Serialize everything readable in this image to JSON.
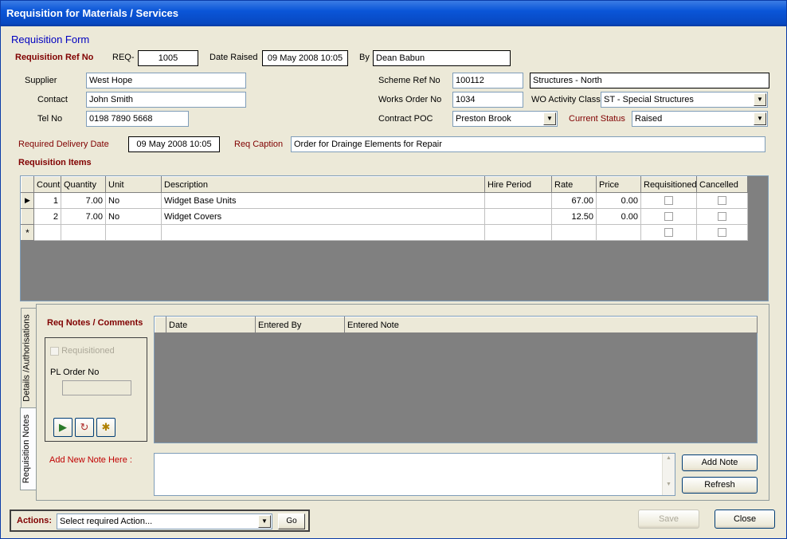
{
  "window": {
    "title": "Requisition for Materials / Services"
  },
  "form": {
    "heading": "Requisition Form",
    "ref_label": "Requisition Ref No",
    "ref_prefix": "REQ-",
    "ref_value": "1005",
    "date_raised_label": "Date Raised",
    "date_raised_value": "09 May 2008 10:05",
    "by_label": "By",
    "by_value": "Dean Babun",
    "supplier_label": "Supplier",
    "supplier_value": "West Hope",
    "contact_label": "Contact",
    "contact_value": "John Smith",
    "tel_label": "Tel No",
    "tel_value": "0198 7890 5668",
    "scheme_label": "Scheme Ref No",
    "scheme_value": "100112",
    "scheme_name": "Structures - North",
    "works_order_label": "Works Order No",
    "works_order_value": "1034",
    "wo_activity_label": "WO Activity Class",
    "wo_activity_value": "ST - Special Structures",
    "contract_poc_label": "Contract POC",
    "contract_poc_value": "Preston Brook",
    "status_label": "Current Status",
    "status_value": "Raised",
    "delivery_label": "Required Delivery Date",
    "delivery_value": "09 May 2008 10:05",
    "caption_label": "Req Caption",
    "caption_value": "Order for Drainge Elements for Repair"
  },
  "items": {
    "heading": "Requisition Items",
    "columns": [
      "Count",
      "Quantity",
      "Unit",
      "Description",
      "Hire Period",
      "Rate",
      "Price",
      "Requisitioned",
      "Cancelled"
    ],
    "rows": [
      {
        "marker": "▶",
        "count": "1",
        "quantity": "7.00",
        "unit": "No",
        "description": "Widget Base Units",
        "hire": "",
        "rate": "67.00",
        "price": "0.00"
      },
      {
        "marker": "",
        "count": "2",
        "quantity": "7.00",
        "unit": "No",
        "description": "Widget Covers",
        "hire": "",
        "rate": "12.50",
        "price": "0.00"
      }
    ],
    "new_row_marker": "*"
  },
  "tabs": {
    "details": "Details /Authorisations",
    "notes": "Requisition Notes"
  },
  "notes": {
    "heading": "Req Notes / Comments",
    "requisitioned_label": "Requisitioned",
    "pl_order_label": "PL Order No",
    "pl_order_value": "",
    "columns": [
      "Date",
      "Entered By",
      "Entered Note"
    ],
    "add_new_label": "Add New Note Here :",
    "new_note_value": "",
    "add_note_button": "Add Note",
    "refresh_button": "Refresh"
  },
  "footer": {
    "actions_label": "Actions:",
    "actions_value": "Select required Action...",
    "go_button": "Go",
    "save_button": "Save",
    "close_button": "Close"
  }
}
